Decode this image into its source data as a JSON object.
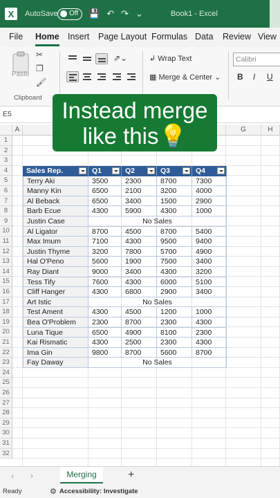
{
  "title_bar": {
    "autosave_label": "AutoSave",
    "toggle_state": "Off",
    "doc_title": "Book1 - Excel"
  },
  "ribbon_tabs": [
    "File",
    "Home",
    "Insert",
    "Page Layout",
    "Formulas",
    "Data",
    "Review",
    "View"
  ],
  "ribbon": {
    "paste_label": "Paste",
    "clipboard_group": "Clipboard",
    "wrap_text": "Wrap Text",
    "merge_center": "Merge & Center",
    "font_name": "Calibri",
    "bold": "B",
    "italic": "I",
    "underline": "U"
  },
  "formula_bar": {
    "name_box": "E5"
  },
  "columns": [
    "A",
    "B",
    "C",
    "D",
    "E",
    "F",
    "G",
    "H"
  ],
  "rows": [
    "1",
    "2",
    "3",
    "4",
    "5",
    "6",
    "7",
    "8",
    "9",
    "10",
    "11",
    "12",
    "13",
    "14",
    "15",
    "16",
    "17",
    "18",
    "19",
    "20",
    "21",
    "22",
    "23",
    "24",
    "25",
    "26",
    "27",
    "28",
    "29",
    "30",
    "31",
    "32"
  ],
  "table": {
    "headers": [
      "Sales Rep.",
      "Q1",
      "Q2",
      "Q3",
      "Q4"
    ],
    "rows": [
      [
        "Terry Aki",
        "3500",
        "2300",
        "8700",
        "7300"
      ],
      [
        "Manny Kin",
        "6500",
        "2100",
        "3200",
        "4000"
      ],
      [
        "Al Beback",
        "6500",
        "3400",
        "1500",
        "2900"
      ],
      [
        "Barb Ecue",
        "4300",
        "5900",
        "4300",
        "1000"
      ],
      [
        "Justin Case",
        "No Sales"
      ],
      [
        "Al Ligator",
        "8700",
        "4500",
        "8700",
        "5400"
      ],
      [
        "Max Imum",
        "7100",
        "4300",
        "9500",
        "9400"
      ],
      [
        "Justin Thyme",
        "3200",
        "7800",
        "5700",
        "4900"
      ],
      [
        "Hal O'Peno",
        "5600",
        "1900",
        "7500",
        "3400"
      ],
      [
        "Ray Diant",
        "9000",
        "3400",
        "4300",
        "3200"
      ],
      [
        "Tess Tify",
        "7600",
        "4300",
        "6000",
        "5100"
      ],
      [
        "Cliff Hanger",
        "4300",
        "6800",
        "2900",
        "3400"
      ],
      [
        "Art Istic",
        "No Sales"
      ],
      [
        "Test Ament",
        "4300",
        "4500",
        "1200",
        "1000"
      ],
      [
        "Bea O'Problem",
        "2300",
        "8700",
        "2300",
        "4300"
      ],
      [
        "Luna Tique",
        "6500",
        "4900",
        "8100",
        "2300"
      ],
      [
        "Kai Rismatic",
        "4300",
        "2500",
        "2300",
        "4300"
      ],
      [
        "Ima Gin",
        "9800",
        "8700",
        "5600",
        "8700"
      ],
      [
        "Fay Daway",
        "No Sales"
      ]
    ]
  },
  "overlay": {
    "line1": "Instead merge",
    "line2": "like this💡"
  },
  "sheet_tabs": {
    "active": "Merging",
    "add": "+"
  },
  "status_bar": {
    "ready": "Ready",
    "accessibility": "Accessibility: Investigate"
  }
}
